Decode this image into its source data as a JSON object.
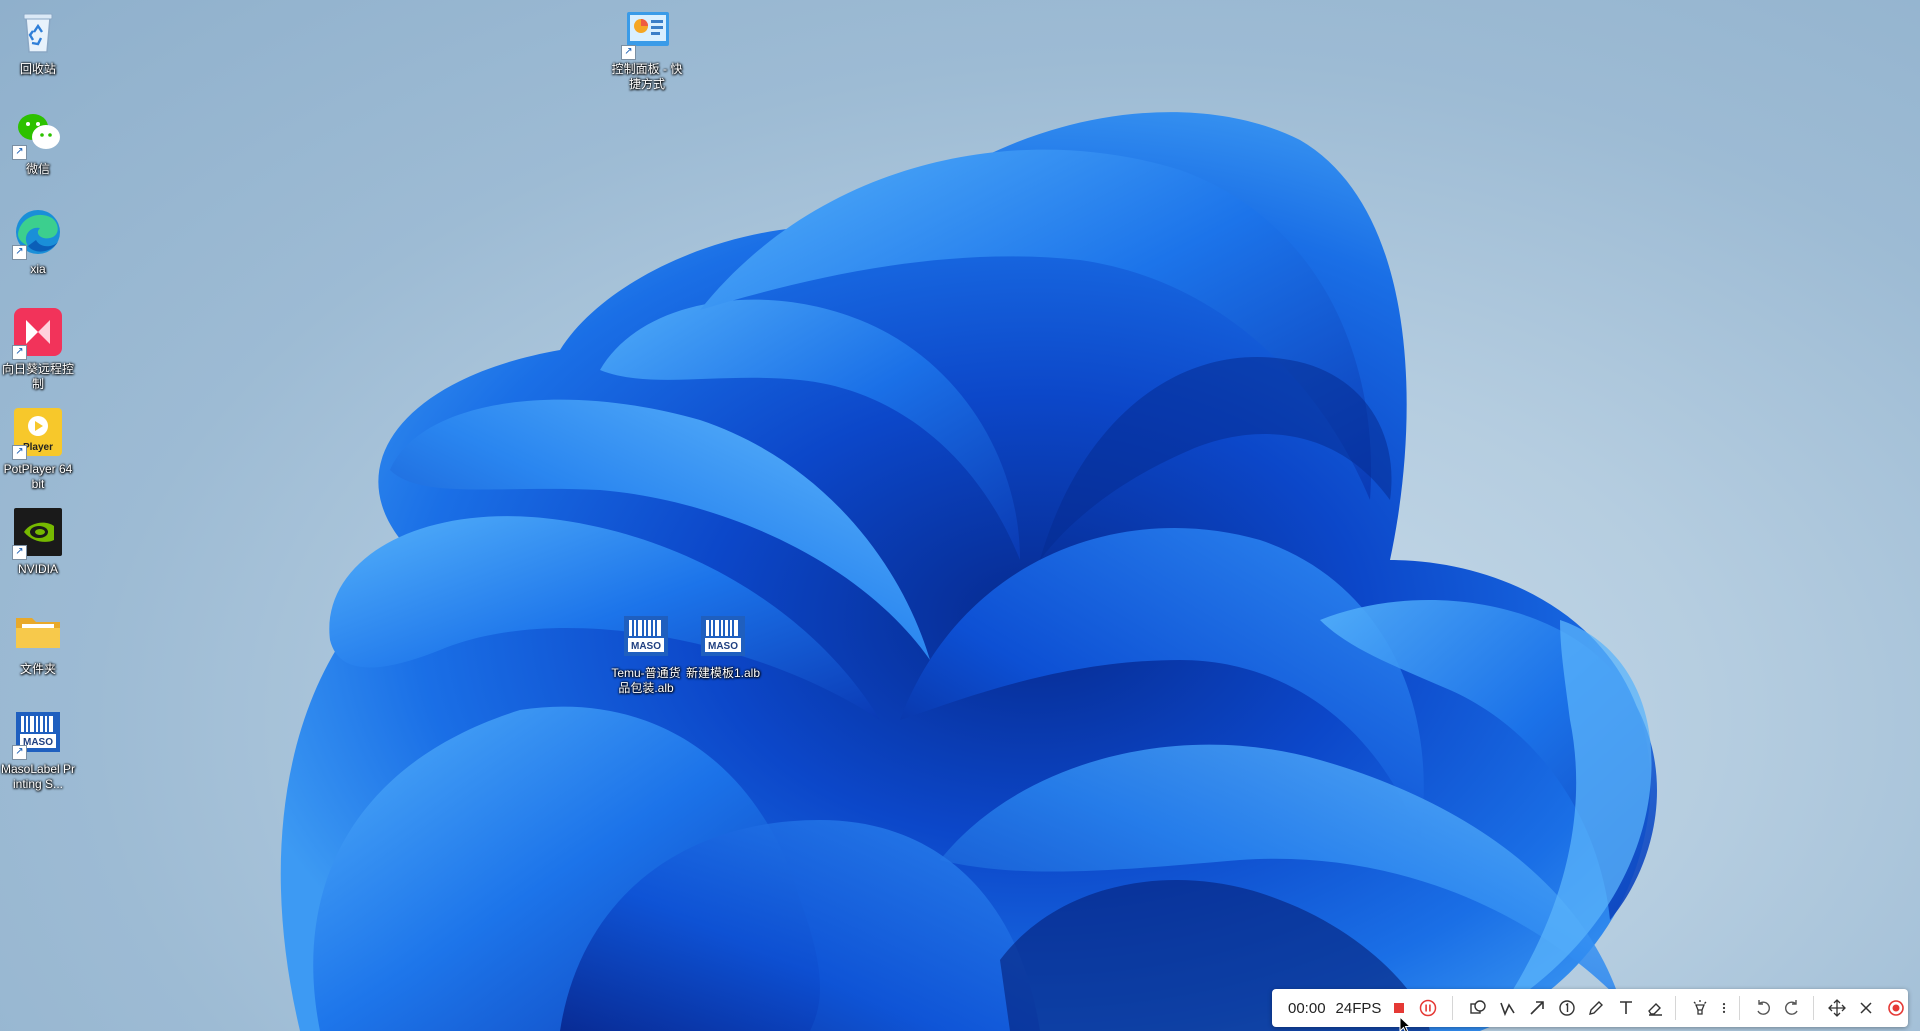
{
  "desktop_icons": [
    {
      "id": "recycle-bin",
      "label": "回收站",
      "icon": "recycle-bin-icon",
      "shortcut": false
    },
    {
      "id": "wechat",
      "label": "微信",
      "icon": "wechat-icon",
      "shortcut": true
    },
    {
      "id": "edge",
      "label": "xia",
      "icon": "edge-icon",
      "shortcut": true
    },
    {
      "id": "sunlogin",
      "label": "向日葵远程控制",
      "icon": "sunlogin-icon",
      "shortcut": true
    },
    {
      "id": "potplayer",
      "label": "PotPlayer 64 bit",
      "icon": "potplayer-icon",
      "shortcut": true
    },
    {
      "id": "nvidia",
      "label": "NVIDIA",
      "icon": "nvidia-icon",
      "shortcut": true
    },
    {
      "id": "folder",
      "label": "文件夹",
      "icon": "folder-icon",
      "shortcut": false
    },
    {
      "id": "masolabel",
      "label": "MasoLabel Printing S...",
      "icon": "masolabel-icon",
      "shortcut": true
    },
    {
      "id": "control-panel",
      "label": "控制面板 - 快捷方式",
      "icon": "control-panel-icon",
      "shortcut": true
    },
    {
      "id": "temu-alb",
      "label": "Temu-普通货品包装.alb",
      "icon": "maso-file-icon",
      "shortcut": false
    },
    {
      "id": "new-template-alb",
      "label": "新建模板1.alb",
      "icon": "maso-file-icon",
      "shortcut": false
    }
  ],
  "maso_badge_text": "MASO",
  "player_badge_text": "Player",
  "recorder": {
    "time": "00:00",
    "fps": "24FPS",
    "stop_color": "#e53935",
    "record_color": "#e53935"
  },
  "colors": {
    "wallpaper_blue": "#1466e0",
    "wallpaper_dark": "#0a2f9a",
    "wallpaper_light": "#3fa0f5"
  }
}
